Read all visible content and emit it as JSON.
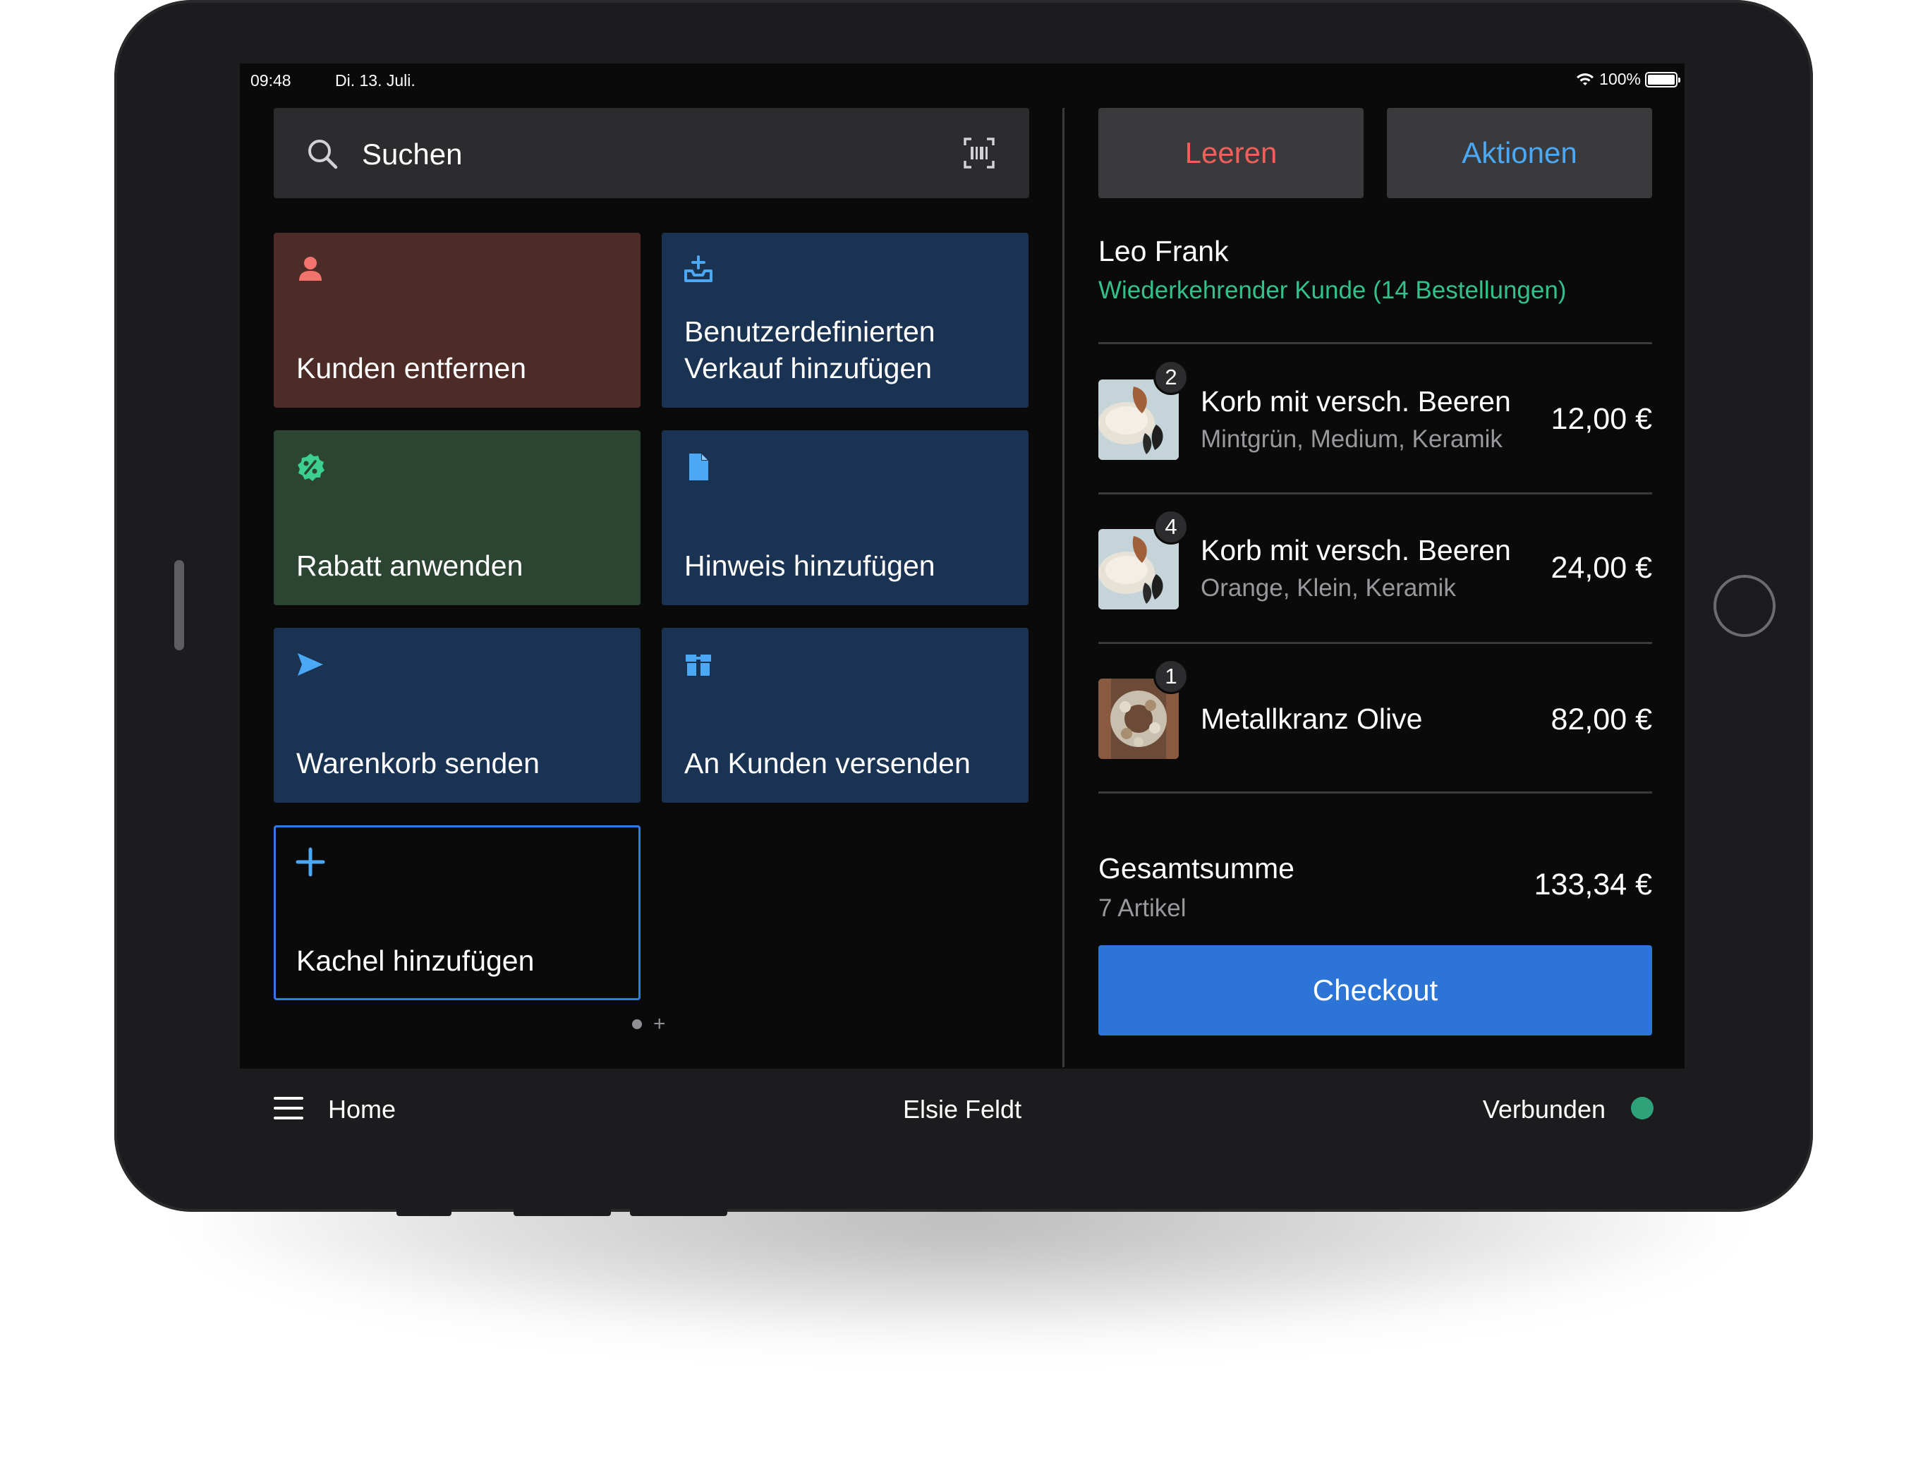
{
  "status_bar": {
    "time": "09:48",
    "date": "Di. 13. Juli.",
    "battery": "100%"
  },
  "search": {
    "placeholder": "Suchen"
  },
  "tiles": [
    {
      "label": "Kunden entfernen",
      "icon": "person-icon",
      "color": "#4d2b26",
      "icon_color": "#f0746c"
    },
    {
      "label": "Benutzerdefinierten Verkauf hinzufügen",
      "icon": "tray-add-icon",
      "color": "#1b3352",
      "icon_color": "#4aa8f5"
    },
    {
      "label": "Rabatt anwenden",
      "icon": "discount-badge-icon",
      "color": "#2c4533",
      "icon_color": "#3ccf8e"
    },
    {
      "label": "Hinweis hinzufügen",
      "icon": "document-icon",
      "color": "#1b3352",
      "icon_color": "#4aa8f5"
    },
    {
      "label": "Warenkorb senden",
      "icon": "send-icon",
      "color": "#1b3352",
      "icon_color": "#4aa8f5"
    },
    {
      "label": "An Kunden versenden",
      "icon": "package-icon",
      "color": "#1b3352",
      "icon_color": "#4aa8f5"
    },
    {
      "label": "Kachel hinzufügen",
      "icon": "plus-icon",
      "color": "#0a0a0b",
      "icon_color": "#4aa8f5"
    }
  ],
  "cart": {
    "clear_label": "Leeren",
    "actions_label": "Aktionen",
    "customer": {
      "name": "Leo Frank",
      "subtitle": "Wiederkehrender Kunde (14 Bestellungen)"
    },
    "items": [
      {
        "qty": "2",
        "name": "Korb mit versch. Beeren",
        "variant": "Mintgrün, Medium, Keramik",
        "price": "12,00 €"
      },
      {
        "qty": "4",
        "name": "Korb mit versch. Beeren",
        "variant": "Orange, Klein, Keramik",
        "price": "24,00 €"
      },
      {
        "qty": "1",
        "name": "Metallkranz Olive",
        "variant": "",
        "price": "82,00 €"
      }
    ],
    "total_label": "Gesamtsumme",
    "total_count": "7 Artikel",
    "total_value": "133,34 €",
    "checkout_label": "Checkout"
  },
  "bottom_bar": {
    "home_label": "Home",
    "user": "Elsie Feldt",
    "status": "Verbunden",
    "status_color": "#2ea37a"
  },
  "colors": {
    "accent": "#2d74d7",
    "danger": "#f0605a",
    "link": "#4aa8f5",
    "success": "#34c08b"
  }
}
